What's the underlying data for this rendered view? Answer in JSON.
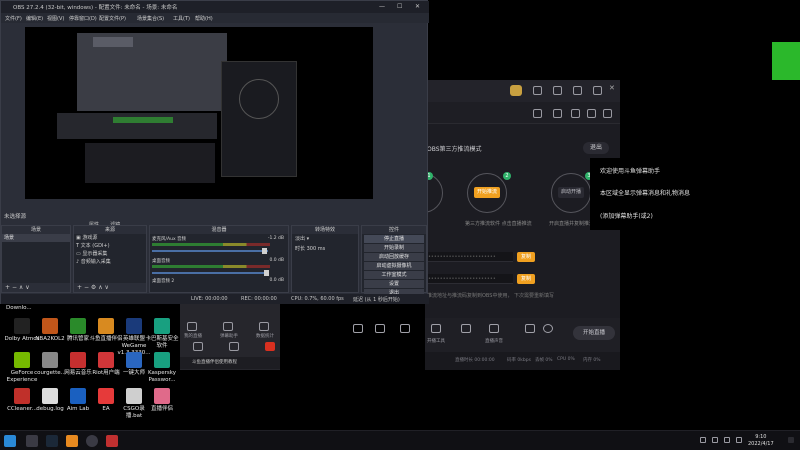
{
  "obs": {
    "title": "OBS 27.2.4 (32-bit, windows) - 配置文件: 未命名 - 场景: 未命名",
    "menus": [
      "文件(F)",
      "编辑(E)",
      "视图(V)",
      "停靠窗口(D)",
      "配置文件(P)",
      "场景集合(S)",
      "工具(T)",
      "帮助(H)"
    ],
    "no_scene": "未选择源",
    "props_label": "属性",
    "filters_label": "滤镜",
    "docks": {
      "scenes": {
        "title": "场景",
        "items": [
          "场景"
        ]
      },
      "sources": {
        "title": "来源",
        "items": [
          "游戏源",
          "文本 (GDI+)",
          "显示器采集",
          "音频输入采集"
        ]
      },
      "mixer": {
        "title": "混音器",
        "channels": [
          {
            "name": "麦克风/Aux 音频",
            "db": "-1.2 dB"
          },
          {
            "name": "桌面音频",
            "db": "0.0 dB"
          },
          {
            "name": "桌面音频 2",
            "db": "0.0 dB"
          }
        ]
      },
      "transitions": {
        "title": "转场特效",
        "type": "淡出",
        "duration_label": "时长",
        "duration": "300 ms"
      },
      "controls": {
        "title": "控件",
        "buttons": [
          "停止直播",
          "开始录制",
          "启动回放缓存",
          "启动虚拟摄像机",
          "工作室模式",
          "设置",
          "退出"
        ]
      }
    },
    "status": {
      "live": "LIVE: 00:00:00",
      "rec": "REC: 00:00:00",
      "cpu": "CPU: 0.7%, 60.00 fps",
      "dropped": "延迟 (从 1 秒后开始)"
    }
  },
  "helper": {
    "mode_title": "OBS第三方推流模式",
    "exit": "退出",
    "steps": [
      {
        "num": "1",
        "btn": "",
        "caption": ""
      },
      {
        "num": "2",
        "btn": "开始推流",
        "caption": "第三方推流软件\n点击直播推流"
      },
      {
        "num": "3",
        "btn": "启动开播",
        "caption": "开启直播并复制推流\n码到OBS"
      }
    ],
    "copy_label": "复制",
    "hint": "推流地址与推流码复制到OBS中使用， 下次需要重新填写",
    "bottom_items": [
      "直播设置",
      "高级设置",
      "房间管理",
      "主播数据",
      "开播工具",
      "直播声音"
    ],
    "start_button": "开始直播",
    "status_items": [
      "直播时长 00:00:00",
      "码率 0kbps",
      "丢帧 0%",
      "CPU 0%",
      "内存 0%"
    ]
  },
  "tips": [
    "欢迎使用斗鱼弹幕助手",
    "本区域全显示弹幕消息和礼物消息",
    "(添加弹幕助手(或2)"
  ],
  "mini_panel": {
    "items": [
      "我的直播",
      "弹幕助手",
      "数据统计",
      "礼物",
      "工具",
      "连麦"
    ],
    "banner": "斗鱼直播伴侣使用教程"
  },
  "desktop": {
    "downloads": "Downlo...",
    "icons": [
      {
        "label": "Dolby Atmos",
        "color": "#222"
      },
      {
        "label": "NBA2KOL2",
        "color": "#c0561a"
      },
      {
        "label": "腾讯管家",
        "color": "#2a8a2a"
      },
      {
        "label": "斗鱼直播伴侣",
        "color": "#d88a20"
      },
      {
        "label": "英雄联盟 WeGame v1.3.3330...",
        "color": "#1a3a7a"
      },
      {
        "label": "卡巴斯基安全软件",
        "color": "#18a080"
      },
      {
        "label": "GeForce Experience",
        "color": "#76b900"
      },
      {
        "label": "courgette...",
        "color": "#888"
      },
      {
        "label": "网易云音乐",
        "color": "#c62f2f"
      },
      {
        "label": "Riot用户端",
        "color": "#d13639"
      },
      {
        "label": "一键大师",
        "color": "#2a66c0"
      },
      {
        "label": "Kaspersky Passwor...",
        "color": "#18a080"
      },
      {
        "label": "CCleaner...",
        "color": "#c0302a"
      },
      {
        "label": "debug.log",
        "color": "#dcdcdc"
      },
      {
        "label": "Aim Lab",
        "color": "#1a60c0"
      },
      {
        "label": "EA",
        "color": "#e63a3a"
      },
      {
        "label": "CSGO录播.bat",
        "color": "#cfcfcf"
      },
      {
        "label": "直播伴侣",
        "color": "#e06a8a"
      }
    ]
  },
  "taskbar": {
    "time": "9:10",
    "date": "2022/4/17",
    "apps": [
      {
        "name": "windows-start",
        "color": "#2a8ad8"
      },
      {
        "name": "search",
        "color": "#3a3a44"
      },
      {
        "name": "steam",
        "color": "#1b2838"
      },
      {
        "name": "douyu",
        "color": "#e88a20"
      },
      {
        "name": "obs",
        "color": "#3a3a44"
      },
      {
        "name": "other",
        "color": "#c03030"
      }
    ]
  }
}
